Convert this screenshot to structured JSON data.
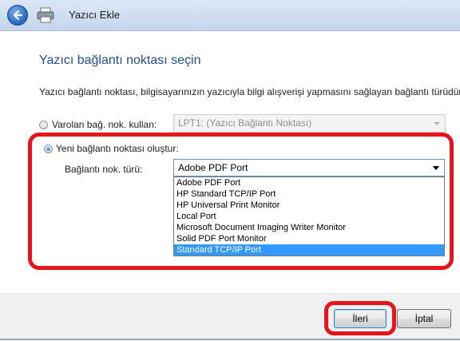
{
  "window": {
    "title": "Yazıcı Ekle"
  },
  "page": {
    "heading": "Yazıcı bağlantı noktası seçin",
    "description": "Yazıcı bağlantı noktası, bilgisayarınızın yazıcıyla bilgi alışverişi yapmasını sağlayan bağlantı türüdür."
  },
  "existing_port": {
    "label": "Varolan bağ. nok. kullan:",
    "selected": "LPT1: (Yazıcı Bağlantı Noktası)",
    "checked": false
  },
  "new_port": {
    "label": "Yeni bağlantı noktası oluştur:",
    "checked": true,
    "type_label": "Bağlantı nok. türü:",
    "selected": "Adobe PDF Port",
    "options": [
      "Adobe PDF Port",
      "HP Standard TCP/IP Port",
      "HP Universal Print Monitor",
      "Local Port",
      "Microsoft Document Imaging Writer Monitor",
      "Solid PDF Port Monitor",
      "Standard TCP/IP Port"
    ],
    "highlighted_option": "Standard TCP/IP Port"
  },
  "buttons": {
    "next": "İleri",
    "cancel": "İptal"
  },
  "colors": {
    "heading": "#1e4f8f",
    "highlight_ring": "#e8141b",
    "selection": "#3399ff"
  }
}
